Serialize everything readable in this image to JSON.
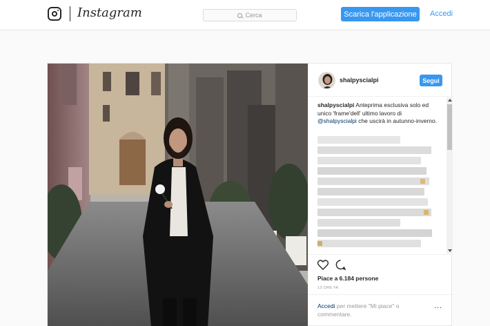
{
  "header": {
    "wordmark": "Instagram",
    "search_placeholder": "Cerca",
    "get_app_label": "Scarica l'applicazione",
    "login_label": "Accedi"
  },
  "post": {
    "username": "shalpyscialpi",
    "follow_label": "Segui",
    "caption": {
      "author": "shalpyscialpi",
      "text_before": "Anteprima esclusiva solo ed unico 'frame'dell' ultimo lavoro di",
      "mention": "@shalpyscialpi",
      "text_after": "che uscirà in autunno-inverno."
    },
    "likes": "Piace a 6.184 persone",
    "time": "13 ORE FA",
    "login_prompt": {
      "link": "Accedi",
      "text": "per mettere \"Mi piace\" o commentare."
    },
    "more_label": "..."
  },
  "icons": {
    "camera": "instagram-camera-icon",
    "search": "search-icon",
    "heart": "heart-icon",
    "comment": "comment-icon",
    "scroll_up": "scroll-up-arrow",
    "scroll_down": "scroll-down-arrow"
  },
  "colors": {
    "accent": "#3897f0",
    "link": "#003569",
    "muted": "#999999",
    "text": "#262626"
  }
}
